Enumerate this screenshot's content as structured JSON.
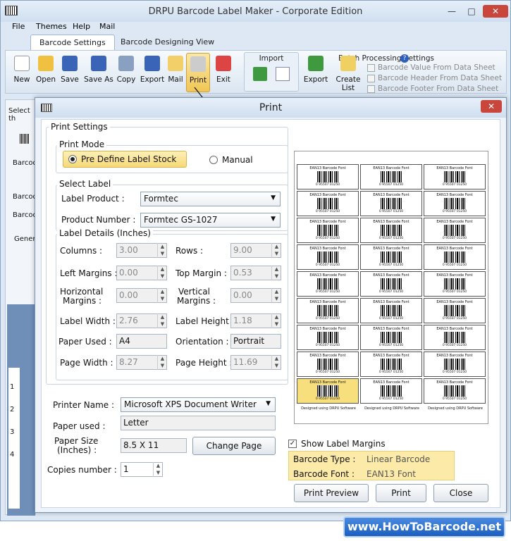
{
  "app": {
    "title": "DRPU Barcode Label Maker - Corporate Edition"
  },
  "menu": [
    "File",
    "Themes",
    "Help",
    "Mail"
  ],
  "tabs": [
    "Barcode Settings",
    "Barcode Designing View"
  ],
  "toolbar": {
    "new": "New",
    "open": "Open",
    "save": "Save",
    "save_as": "Save As",
    "copy": "Copy",
    "export": "Export",
    "mail": "Mail",
    "print": "Print",
    "exit": "Exit"
  },
  "import": {
    "label": "Import"
  },
  "batch": {
    "title": "Batch Processing Settings",
    "export": "Export",
    "create_list": "Create List",
    "opt1": "Barcode Value From Data Sheet",
    "opt2": "Barcode Header From Data Sheet",
    "opt3": "Barcode Footer From Data Sheet"
  },
  "left": {
    "l1": "Select th",
    "l2": "Barcod",
    "l3": "Barcod",
    "l4": "Barcod",
    "l5": "Genera",
    "r1": "1",
    "r2": "2",
    "r3": "3",
    "r4": "4"
  },
  "dialog": {
    "title": "Print",
    "print_settings": "Print Settings",
    "print_mode": "Print Mode",
    "predefine": "Pre Define Label Stock",
    "manual": "Manual",
    "select_label": "Select Label",
    "label_product_lbl": "Label Product :",
    "label_product": "Formtec",
    "product_number_lbl": "Product Number :",
    "product_number": "Formtec GS-1027",
    "label_details": "Label Details (Inches)",
    "columns_lbl": "Columns :",
    "columns": "3.00",
    "rows_lbl": "Rows :",
    "rows": "9.00",
    "left_margins_lbl": "Left Margins :",
    "left_margins": "0.00",
    "top_margin_lbl": "Top Margin :",
    "top_margin": "0.53",
    "h_margins_lbl1": "Horizontal",
    "h_margins_lbl2": "Margins :",
    "h_margins": "0.00",
    "v_margins_lbl1": "Vertical",
    "v_margins_lbl2": "Margins :",
    "v_margins": "0.00",
    "label_width_lbl": "Label Width :",
    "label_width": "2.76",
    "label_height_lbl": "Label Height :",
    "label_height": "1.18",
    "paper_used_lbl": "Paper Used :",
    "paper_used": "A4",
    "orientation_lbl": "Orientation :",
    "orientation": "Portrait",
    "page_width_lbl": "Page Width :",
    "page_width": "8.27",
    "page_height_lbl": "Page Height :",
    "page_height": "11.69",
    "printer_name_lbl": "Printer Name :",
    "printer_name": "Microsoft XPS Document Writer",
    "paper_used2_lbl": "Paper used :",
    "paper_used2": "Letter",
    "paper_size_lbl1": "Paper Size",
    "paper_size_lbl2": "(Inches) :",
    "paper_size": "8.5 X 11",
    "change_page": "Change Page",
    "copies_lbl": "Copies number :",
    "copies": "1",
    "show_margins": "Show Label Margins",
    "barcode_type_lbl": "Barcode Type :",
    "barcode_type": "Linear Barcode",
    "barcode_font_lbl": "Barcode Font :",
    "barcode_font": "EAN13 Font",
    "print_preview": "Print Preview",
    "print": "Print",
    "close": "Close"
  },
  "preview": {
    "cell_title": "EAN13 Barcode Font",
    "cell_number": "0  95507  01250",
    "footer": "Designed using DRPU Software",
    "rows": 9,
    "cols": 3,
    "highlight_row": 8,
    "highlight_col": 0
  },
  "watermark": "www.HowToBarcode.net"
}
